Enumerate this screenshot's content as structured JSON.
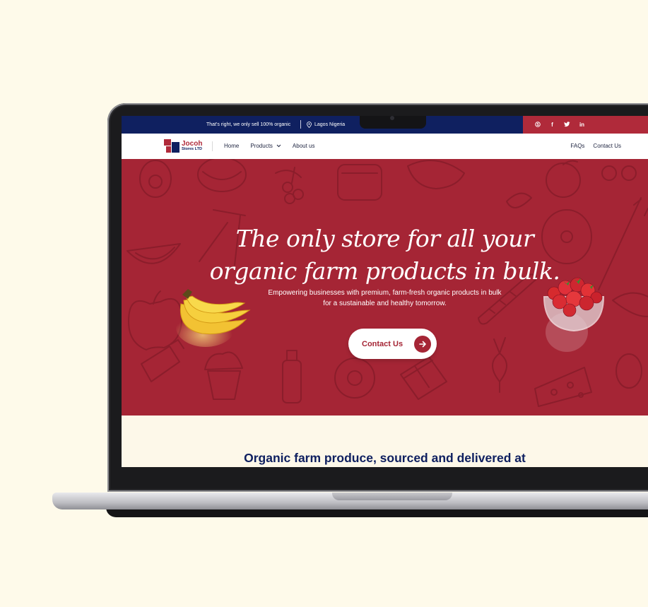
{
  "colors": {
    "brand_red": "#a52535",
    "brand_navy": "#0f2060",
    "page_background": "#fefaea"
  },
  "topbar": {
    "tagline": "That's right, we only sell 100% organic",
    "location": "Lagos Nigeria",
    "social_icons": [
      "skype-icon",
      "facebook-icon",
      "twitter-icon",
      "linkedin-icon"
    ]
  },
  "nav": {
    "logo_name": "Jocoh",
    "logo_sub": "Stores LTD",
    "links": [
      "Home",
      "Products",
      "About us"
    ],
    "right_links": [
      "FAQs",
      "Contact Us"
    ]
  },
  "hero": {
    "title_line1": "The only store  for all your",
    "title_line2": "organic farm products in bulk.",
    "subtitle_line1": "Empowering businesses with premium, farm-fresh organic products in bulk",
    "subtitle_line2": "for a sustainable and healthy tomorrow.",
    "cta_label": "Contact Us"
  },
  "section": {
    "heading": "Organic farm produce, sourced and delivered at"
  }
}
